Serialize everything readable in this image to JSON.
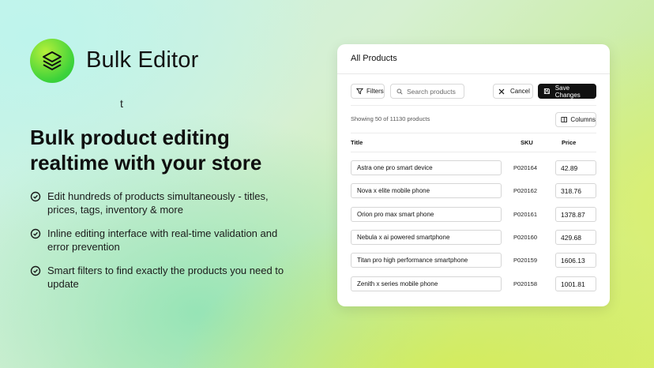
{
  "brand": {
    "name": "Bulk Editor",
    "stray_char": "t",
    "logo_icon": "layers-icon"
  },
  "headline": {
    "line1": "Bulk product editing",
    "line2": "realtime with your store"
  },
  "features": [
    {
      "icon": "check-circle-icon",
      "text": "Edit hundreds of products simultaneously - titles, prices, tags, inventory & more"
    },
    {
      "icon": "check-circle-icon",
      "text": "Inline editing interface with real-time validation and error prevention"
    },
    {
      "icon": "check-circle-icon",
      "text": "Smart filters to find exactly the products you need to update"
    }
  ],
  "panel": {
    "title": "All Products",
    "toolbar": {
      "filters_label": "Filters",
      "search_placeholder": "Search products",
      "cancel_label": "Cancel",
      "save_label": "Save Changes"
    },
    "showing_text": "Showing 50 of 11130 products",
    "columns_label": "Columns",
    "table": {
      "headers": {
        "title": "Title",
        "sku": "SKU",
        "price": "Price"
      },
      "rows": [
        {
          "title": "Astra one pro smart device",
          "sku": "P020164",
          "price": "42.89"
        },
        {
          "title": "Nova x elite mobile phone",
          "sku": "P020162",
          "price": "318.76"
        },
        {
          "title": "Orion pro max smart phone",
          "sku": "P020161",
          "price": "1378.87"
        },
        {
          "title": "Nebula x ai powered smartphone",
          "sku": "P020160",
          "price": "429.68"
        },
        {
          "title": "Titan pro high performance smartphone",
          "sku": "P020159",
          "price": "1606.13"
        },
        {
          "title": "Zenith x series mobile phone",
          "sku": "P020158",
          "price": "1001.81"
        }
      ]
    }
  },
  "colors": {
    "accent_green": "#3bd23a",
    "dark_button": "#111111"
  }
}
